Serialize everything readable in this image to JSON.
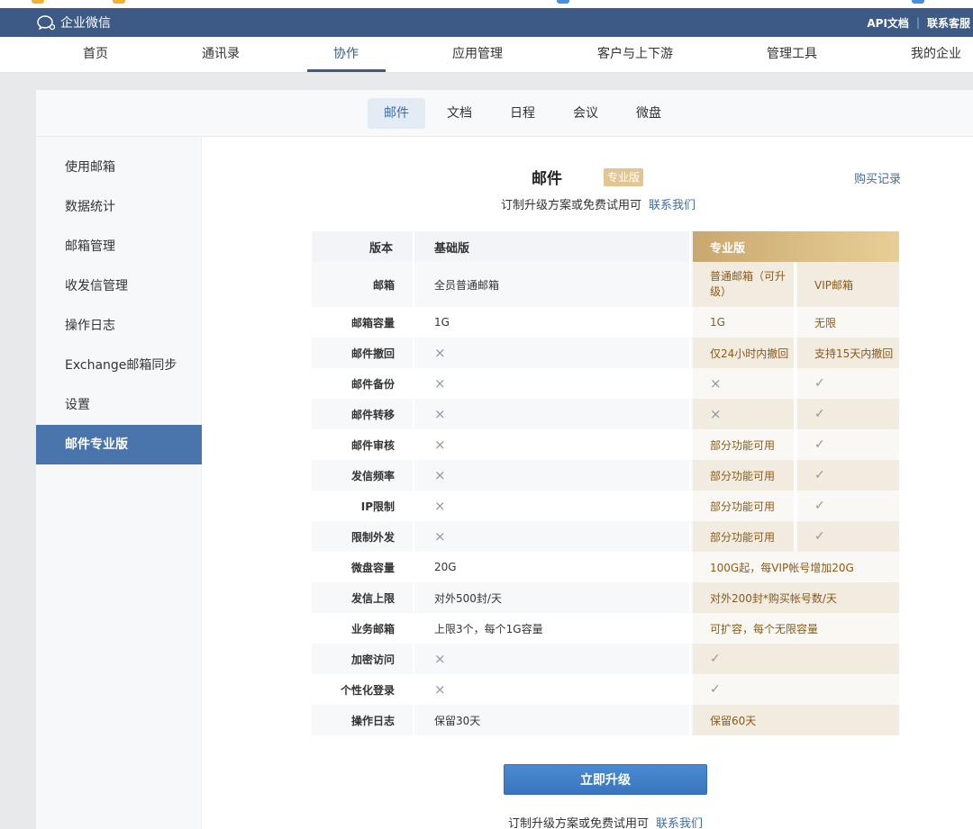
{
  "app": {
    "name": "企业微信",
    "colors": {
      "brand": "#3c5a85",
      "accent": "#4975ac",
      "pro_gold": "#e1c691"
    }
  },
  "top_links": {
    "api": "API文档",
    "support": "联系客服"
  },
  "nav": [
    {
      "label": "首页",
      "active": false
    },
    {
      "label": "通讯录",
      "active": false
    },
    {
      "label": "协作",
      "active": true
    },
    {
      "label": "应用管理",
      "active": false
    },
    {
      "label": "客户与上下游",
      "active": false
    },
    {
      "label": "管理工具",
      "active": false
    },
    {
      "label": "我的企业",
      "active": false
    }
  ],
  "subtabs": [
    {
      "label": "邮件",
      "active": true
    },
    {
      "label": "文档",
      "active": false
    },
    {
      "label": "日程",
      "active": false
    },
    {
      "label": "会议",
      "active": false
    },
    {
      "label": "微盘",
      "active": false
    }
  ],
  "sidebar": [
    {
      "label": "使用邮箱",
      "active": false
    },
    {
      "label": "数据统计",
      "active": false
    },
    {
      "label": "邮箱管理",
      "active": false
    },
    {
      "label": "收发信管理",
      "active": false
    },
    {
      "label": "操作日志",
      "active": false
    },
    {
      "label": "Exchange邮箱同步",
      "active": false
    },
    {
      "label": "设置",
      "active": false
    },
    {
      "label": "邮件专业版",
      "active": true
    }
  ],
  "main": {
    "title": "邮件",
    "badge": "专业版",
    "purchase_link": "购买记录",
    "subtitle": "订制升级方案或免费试用可",
    "contact_link": "联系我们",
    "upgrade_button": "立即升级",
    "footer_text": "订制升级方案或免费试用可",
    "footer_link": "联系我们"
  },
  "table": {
    "header": {
      "label": "版本",
      "basic": "基础版",
      "pro": "专业版"
    },
    "rows": [
      {
        "label": "邮箱",
        "basic": "全员普通邮箱",
        "pro1": "普通邮箱（可升级）",
        "pro2": "VIP邮箱"
      },
      {
        "label": "邮箱容量",
        "basic": "1G",
        "pro1": "1G",
        "pro2": "无限"
      },
      {
        "label": "邮件撤回",
        "basic": "×",
        "pro1": "仅24小时内撤回",
        "pro2": "支持15天内撤回"
      },
      {
        "label": "邮件备份",
        "basic": "×",
        "pro1": "×",
        "pro2": "✓"
      },
      {
        "label": "邮件转移",
        "basic": "×",
        "pro1": "×",
        "pro2": "✓"
      },
      {
        "label": "邮件审核",
        "basic": "×",
        "pro1": "部分功能可用",
        "pro2": "✓"
      },
      {
        "label": "发信频率",
        "basic": "×",
        "pro1": "部分功能可用",
        "pro2": "✓"
      },
      {
        "label": "IP限制",
        "basic": "×",
        "pro1": "部分功能可用",
        "pro2": "✓"
      },
      {
        "label": "限制外发",
        "basic": "×",
        "pro1": "部分功能可用",
        "pro2": "✓"
      },
      {
        "label": "微盘容量",
        "basic": "20G",
        "pro": "100G起，每VIP帐号增加20G"
      },
      {
        "label": "发信上限",
        "basic": "对外500封/天",
        "pro": "对外200封*购买帐号数/天"
      },
      {
        "label": "业务邮箱",
        "basic": "上限3个，每个1G容量",
        "pro": "可扩容，每个无限容量"
      },
      {
        "label": "加密访问",
        "basic": "×",
        "pro": "✓"
      },
      {
        "label": "个性化登录",
        "basic": "×",
        "pro": "✓"
      },
      {
        "label": "操作日志",
        "basic": "保留30天",
        "pro": "保留60天"
      }
    ]
  }
}
